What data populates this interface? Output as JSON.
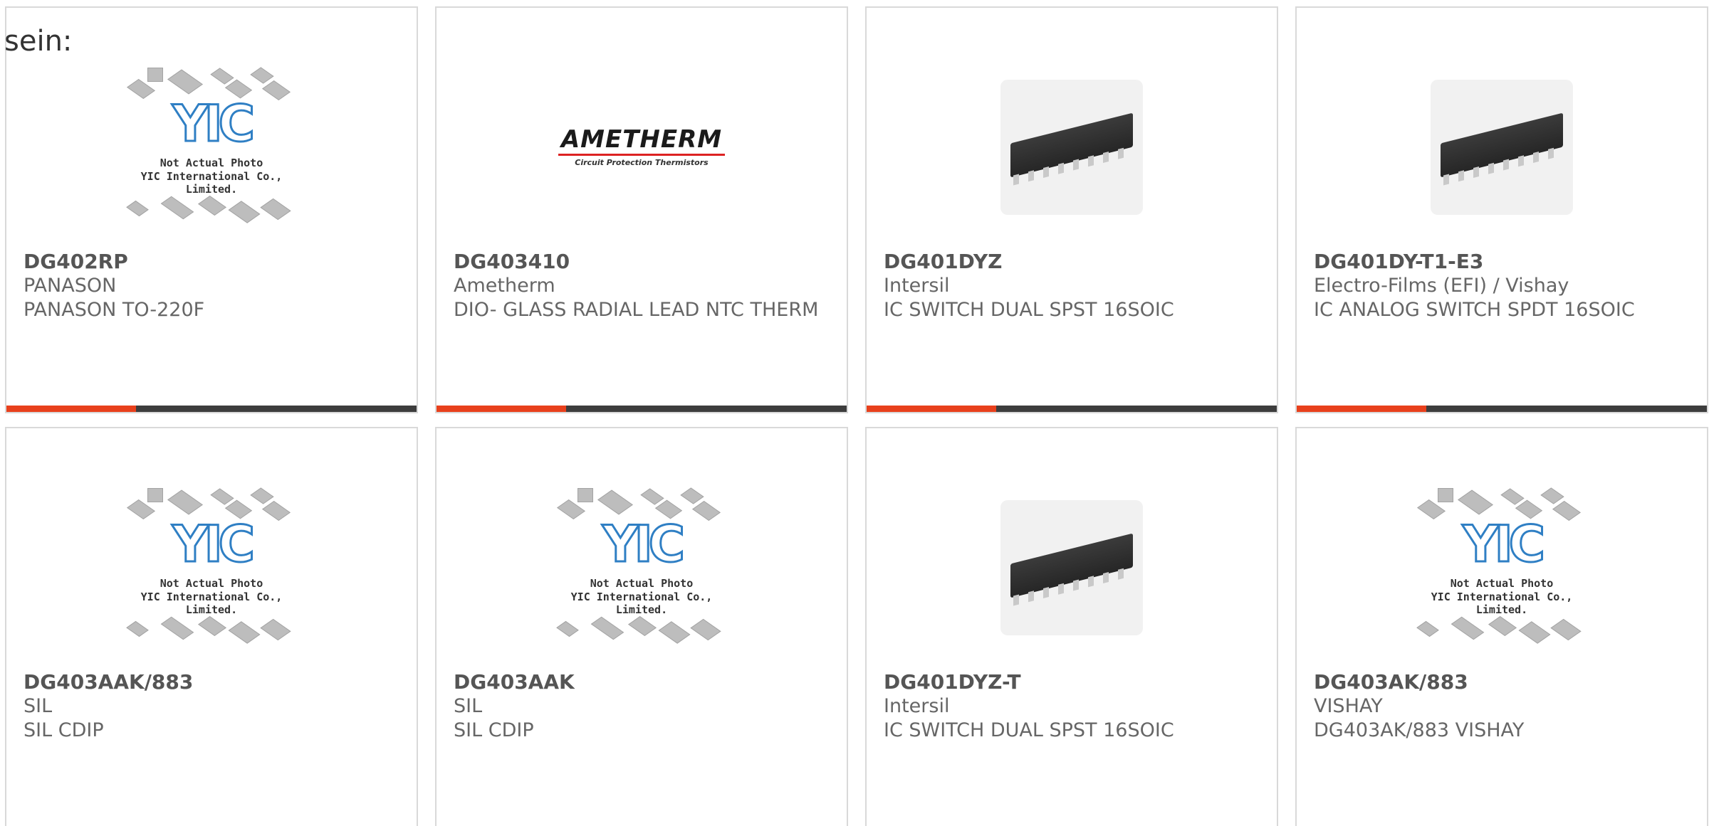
{
  "intro_text": "sein:",
  "placeholder_caption": {
    "line1": "Not Actual Photo",
    "line2": "YIC International Co., Limited.",
    "logo_text": "YIC"
  },
  "accent_color": "#e8401c",
  "products": [
    {
      "part": "DG402RP",
      "maker": "PANASON",
      "desc": "PANASON TO-220F",
      "image": "yic-placeholder"
    },
    {
      "part": "DG403410",
      "maker": "Ametherm",
      "desc": "DIO- GLASS RADIAL LEAD NTC THERM",
      "image": "ametherm-logo",
      "brand_logo": {
        "main": "AMETHERM",
        "sub": "Circuit Protection Thermistors"
      }
    },
    {
      "part": "DG401DYZ",
      "maker": "Intersil",
      "desc": "IC SWITCH DUAL SPST 16SOIC",
      "image": "soic-16"
    },
    {
      "part": "DG401DY-T1-E3",
      "maker": "Electro-Films (EFI) / Vishay",
      "desc": "IC ANALOG SWITCH SPDT 16SOIC",
      "image": "soic-16"
    },
    {
      "part": "DG403AAK/883",
      "maker": "SIL",
      "desc": "SIL CDIP",
      "image": "yic-placeholder"
    },
    {
      "part": "DG403AAK",
      "maker": "SIL",
      "desc": "SIL CDIP",
      "image": "yic-placeholder"
    },
    {
      "part": "DG401DYZ-T",
      "maker": "Intersil",
      "desc": "IC SWITCH DUAL SPST 16SOIC",
      "image": "soic-16"
    },
    {
      "part": "DG403AK/883",
      "maker": "VISHAY",
      "desc": "DG403AK/883 VISHAY",
      "image": "yic-placeholder"
    }
  ]
}
